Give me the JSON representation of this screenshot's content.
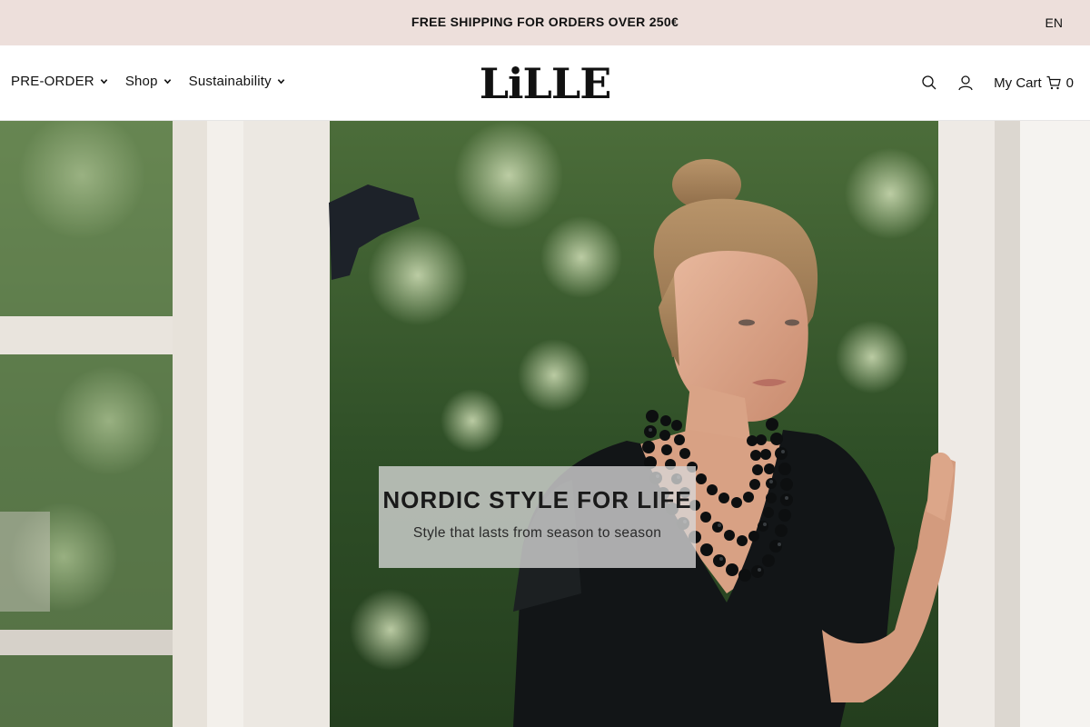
{
  "announcement": {
    "text": "FREE SHIPPING FOR ORDERS OVER 250€",
    "language": "EN"
  },
  "header": {
    "logo_text": "LiLLE",
    "nav": [
      {
        "label": "PRE-ORDER"
      },
      {
        "label": "Shop"
      },
      {
        "label": "Sustainability"
      }
    ],
    "cart": {
      "label": "My Cart",
      "count": "0"
    },
    "icons": [
      "search-icon",
      "account-icon",
      "cart-icon",
      "chevron-down-icon"
    ]
  },
  "hero": {
    "title": "NORDIC STYLE FOR LIFE",
    "subtitle": "Style that lasts from season to season",
    "image": "woman-with-black-bead-necklace-at-window"
  },
  "colors": {
    "announcement_bg": "#eddfdb",
    "text": "#111111",
    "caption_bg": "#d7d7d7"
  }
}
